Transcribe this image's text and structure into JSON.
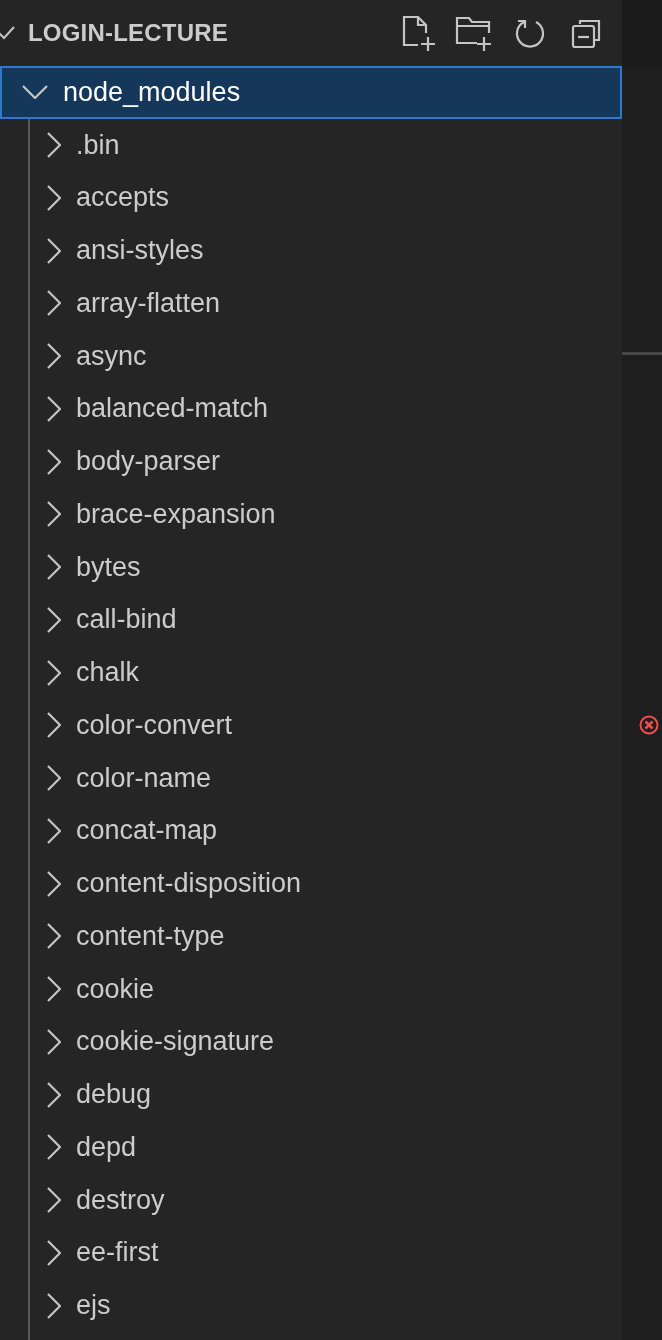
{
  "sidebar": {
    "title": "LOGIN-LECTURE",
    "expanded": true,
    "tree": [
      {
        "label": "node_modules",
        "expanded": true,
        "selected": true,
        "children": [
          {
            "label": ".bin",
            "expanded": false,
            "selected": false
          },
          {
            "label": "accepts",
            "expanded": false,
            "selected": false
          },
          {
            "label": "ansi-styles",
            "expanded": false,
            "selected": false
          },
          {
            "label": "array-flatten",
            "expanded": false,
            "selected": false
          },
          {
            "label": "async",
            "expanded": false,
            "selected": false
          },
          {
            "label": "balanced-match",
            "expanded": false,
            "selected": false
          },
          {
            "label": "body-parser",
            "expanded": false,
            "selected": false
          },
          {
            "label": "brace-expansion",
            "expanded": false,
            "selected": false
          },
          {
            "label": "bytes",
            "expanded": false,
            "selected": false
          },
          {
            "label": "call-bind",
            "expanded": false,
            "selected": false
          },
          {
            "label": "chalk",
            "expanded": false,
            "selected": false
          },
          {
            "label": "color-convert",
            "expanded": false,
            "selected": false
          },
          {
            "label": "color-name",
            "expanded": false,
            "selected": false
          },
          {
            "label": "concat-map",
            "expanded": false,
            "selected": false
          },
          {
            "label": "content-disposition",
            "expanded": false,
            "selected": false
          },
          {
            "label": "content-type",
            "expanded": false,
            "selected": false
          },
          {
            "label": "cookie",
            "expanded": false,
            "selected": false
          },
          {
            "label": "cookie-signature",
            "expanded": false,
            "selected": false
          },
          {
            "label": "debug",
            "expanded": false,
            "selected": false
          },
          {
            "label": "depd",
            "expanded": false,
            "selected": false
          },
          {
            "label": "destroy",
            "expanded": false,
            "selected": false
          },
          {
            "label": "ee-first",
            "expanded": false,
            "selected": false
          },
          {
            "label": "ejs",
            "expanded": false,
            "selected": false
          }
        ]
      }
    ]
  }
}
